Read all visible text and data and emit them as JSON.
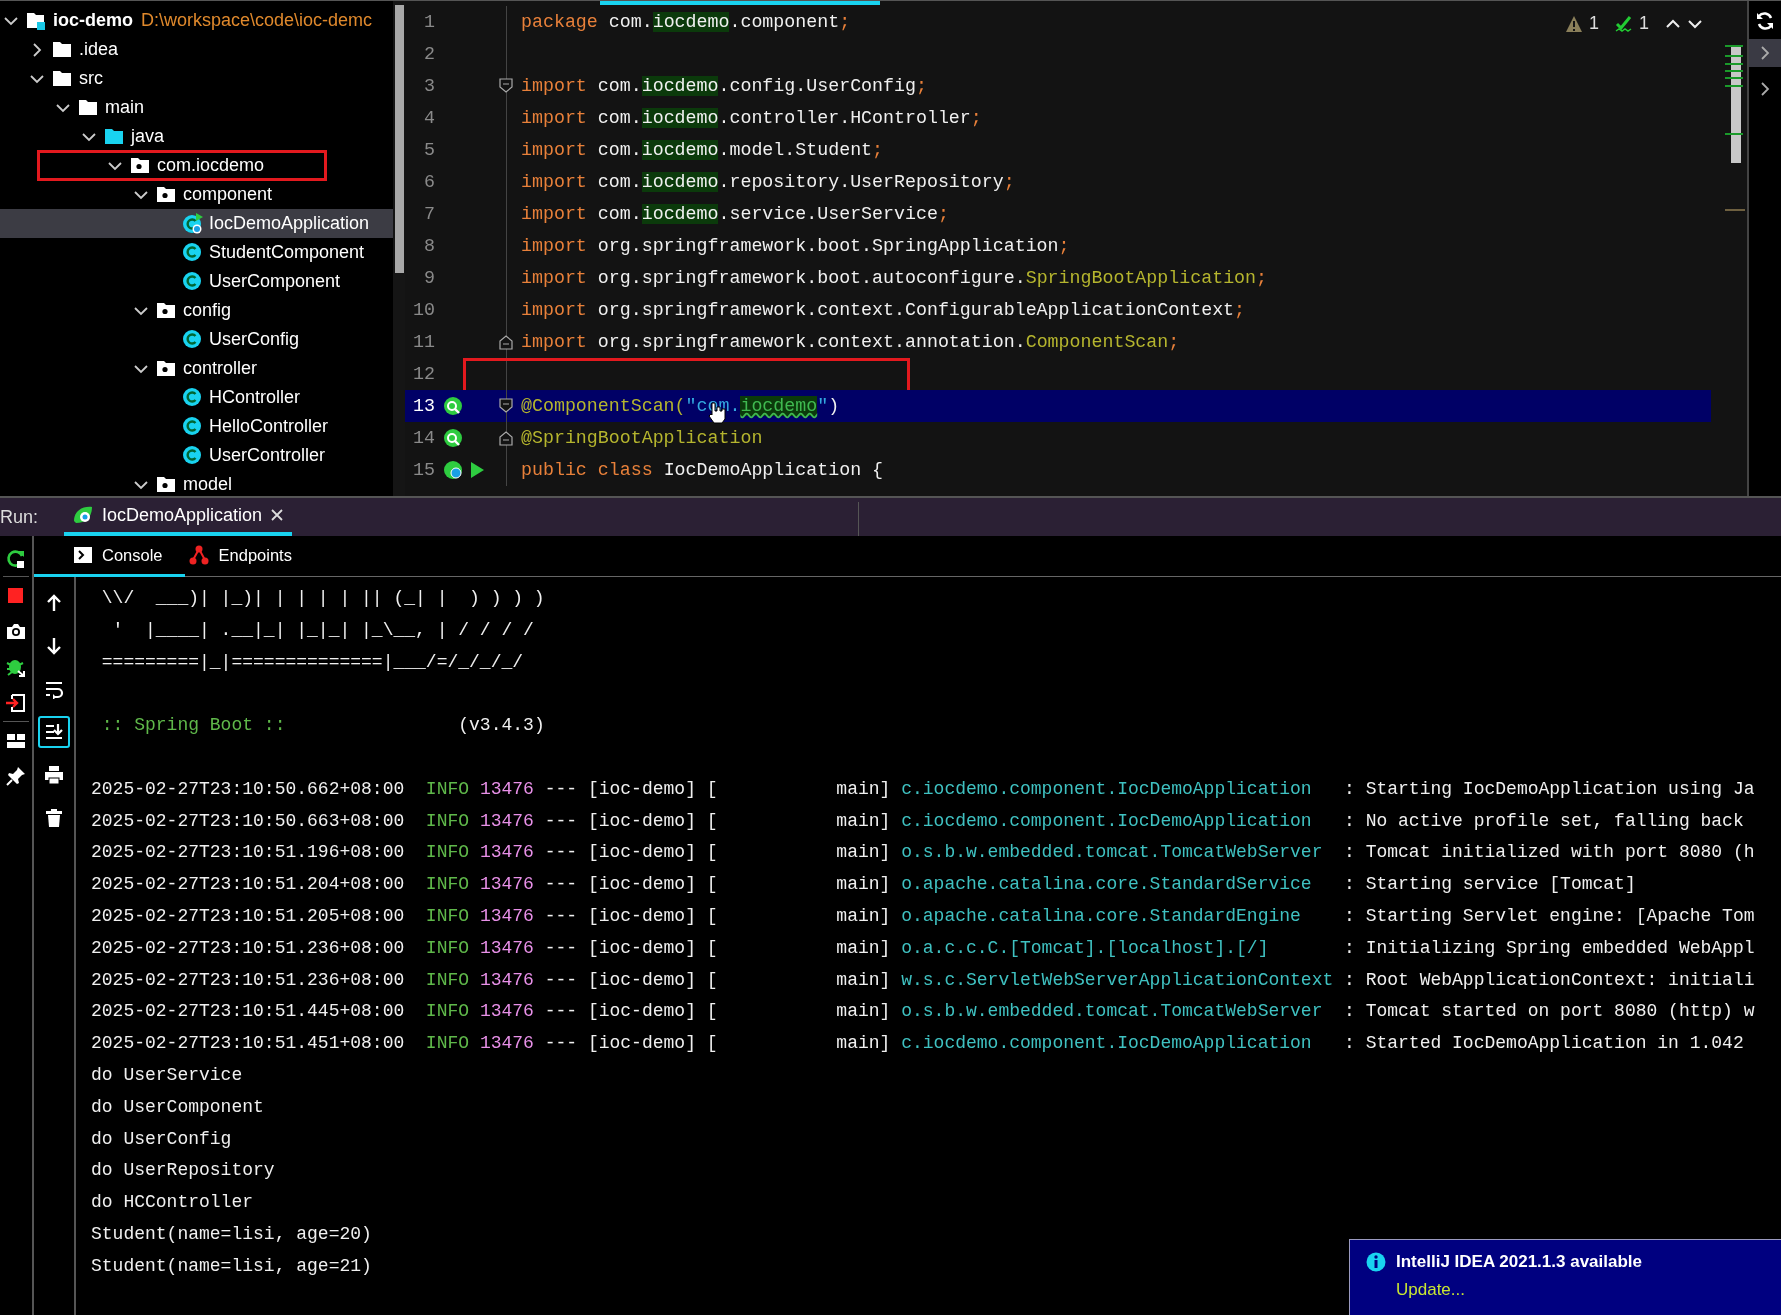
{
  "project_tree": {
    "items": [
      {
        "kind": "module",
        "label": "ioc-demo",
        "path": "D:\\workspace\\code\\ioc-demc",
        "expanded": true,
        "selected": false,
        "children": [
          {
            "kind": "folder",
            "label": ".idea",
            "expanded": false,
            "selected": false
          },
          {
            "kind": "folder",
            "label": "src",
            "expanded": true,
            "selected": false,
            "children": [
              {
                "kind": "folder",
                "label": "main",
                "expanded": true,
                "selected": false,
                "children": [
                  {
                    "kind": "source-root",
                    "label": "java",
                    "expanded": true,
                    "selected": false,
                    "children": [
                      {
                        "kind": "package",
                        "label": "com.iocdemo",
                        "expanded": true,
                        "selected": false,
                        "boxed": true,
                        "children": [
                          {
                            "kind": "package",
                            "label": "component",
                            "expanded": true,
                            "selected": false,
                            "children": [
                              {
                                "kind": "app-class",
                                "label": "IocDemoApplication",
                                "selected": true
                              },
                              {
                                "kind": "class",
                                "label": "StudentComponent",
                                "selected": false
                              },
                              {
                                "kind": "class",
                                "label": "UserComponent",
                                "selected": false
                              }
                            ]
                          },
                          {
                            "kind": "package",
                            "label": "config",
                            "expanded": true,
                            "selected": false,
                            "children": [
                              {
                                "kind": "class",
                                "label": "UserConfig",
                                "selected": false
                              }
                            ]
                          },
                          {
                            "kind": "package",
                            "label": "controller",
                            "expanded": true,
                            "selected": false,
                            "children": [
                              {
                                "kind": "class",
                                "label": "HController",
                                "selected": false
                              },
                              {
                                "kind": "class",
                                "label": "HelloController",
                                "selected": false
                              },
                              {
                                "kind": "class",
                                "label": "UserController",
                                "selected": false
                              }
                            ]
                          },
                          {
                            "kind": "package",
                            "label": "model",
                            "expanded": true,
                            "selected": false
                          }
                        ]
                      }
                    ]
                  }
                ]
              }
            ]
          }
        ]
      }
    ]
  },
  "editor": {
    "inspections": [
      {
        "kind": "warning",
        "count": "1"
      },
      {
        "kind": "typo",
        "count": "1"
      }
    ],
    "lines": [
      {
        "number": "1",
        "current": false,
        "tokens": [
          {
            "kind": "kw",
            "text": "package"
          },
          {
            "kind": "plain",
            "text": " com."
          },
          {
            "kind": "match",
            "text": "iocdemo"
          },
          {
            "kind": "plain",
            "text": ".component"
          },
          {
            "kind": "punc",
            "text": ";"
          }
        ]
      },
      {
        "number": "2",
        "current": false
      },
      {
        "number": "3",
        "current": false,
        "fold_start": true,
        "tokens": [
          {
            "kind": "kw",
            "text": "import"
          },
          {
            "kind": "plain",
            "text": " com."
          },
          {
            "kind": "match",
            "text": "iocdemo"
          },
          {
            "kind": "plain",
            "text": ".config.UserConfig"
          },
          {
            "kind": "punc",
            "text": ";"
          }
        ]
      },
      {
        "number": "4",
        "current": false,
        "tokens": [
          {
            "kind": "kw",
            "text": "import"
          },
          {
            "kind": "plain",
            "text": " com."
          },
          {
            "kind": "match",
            "text": "iocdemo"
          },
          {
            "kind": "plain",
            "text": ".controller.HController"
          },
          {
            "kind": "punc",
            "text": ";"
          }
        ]
      },
      {
        "number": "5",
        "current": false,
        "tokens": [
          {
            "kind": "kw",
            "text": "import"
          },
          {
            "kind": "plain",
            "text": " com."
          },
          {
            "kind": "match",
            "text": "iocdemo"
          },
          {
            "kind": "plain",
            "text": ".model.Student"
          },
          {
            "kind": "punc",
            "text": ";"
          }
        ]
      },
      {
        "number": "6",
        "current": false,
        "tokens": [
          {
            "kind": "kw",
            "text": "import"
          },
          {
            "kind": "plain",
            "text": " com."
          },
          {
            "kind": "match",
            "text": "iocdemo"
          },
          {
            "kind": "plain",
            "text": ".repository.UserRepository"
          },
          {
            "kind": "punc",
            "text": ";"
          }
        ]
      },
      {
        "number": "7",
        "current": false,
        "tokens": [
          {
            "kind": "kw",
            "text": "import"
          },
          {
            "kind": "plain",
            "text": " com."
          },
          {
            "kind": "match",
            "text": "iocdemo"
          },
          {
            "kind": "plain",
            "text": ".service.UserService"
          },
          {
            "kind": "punc",
            "text": ";"
          }
        ]
      },
      {
        "number": "8",
        "current": false,
        "tokens": [
          {
            "kind": "kw",
            "text": "import"
          },
          {
            "kind": "plain",
            "text": " org.springframework.boot.SpringApplication"
          },
          {
            "kind": "punc",
            "text": ";"
          }
        ]
      },
      {
        "number": "9",
        "current": false,
        "tokens": [
          {
            "kind": "kw",
            "text": "import"
          },
          {
            "kind": "plain",
            "text": " org.springframework.boot.autoconfigure."
          },
          {
            "kind": "ann",
            "text": "SpringBootApplication"
          },
          {
            "kind": "punc",
            "text": ";"
          }
        ]
      },
      {
        "number": "10",
        "current": false,
        "tokens": [
          {
            "kind": "kw",
            "text": "import"
          },
          {
            "kind": "plain",
            "text": " org.springframework.context.ConfigurableApplicationContext"
          },
          {
            "kind": "punc",
            "text": ";"
          }
        ]
      },
      {
        "number": "11",
        "current": false,
        "fold_end": true,
        "tokens": [
          {
            "kind": "kw",
            "text": "import"
          },
          {
            "kind": "plain",
            "text": " org.springframework.context.annotation."
          },
          {
            "kind": "ann",
            "text": "ComponentScan"
          },
          {
            "kind": "punc",
            "text": ";"
          }
        ]
      },
      {
        "number": "12",
        "current": false,
        "boxed": true
      },
      {
        "number": "13",
        "current": true,
        "boxed": true,
        "bean": true,
        "fold_start": true,
        "pointer": true,
        "tokens": [
          {
            "kind": "ann",
            "text": "@ComponentScan("
          },
          {
            "kind": "str",
            "text": "\"com."
          },
          {
            "kind": "typo",
            "text": "iocdemo"
          },
          {
            "kind": "str",
            "text": "\""
          },
          {
            "kind": "plain",
            "text": ")"
          }
        ]
      },
      {
        "number": "14",
        "current": false,
        "bean": true,
        "fold_end": true,
        "tokens": [
          {
            "kind": "ann",
            "text": "@SpringBootApplication"
          }
        ]
      },
      {
        "number": "15",
        "current": false,
        "bean": true,
        "run": true,
        "tokens": [
          {
            "kind": "kw",
            "text": "public class"
          },
          {
            "kind": "plain",
            "text": " IocDemoApplication {"
          }
        ]
      }
    ]
  },
  "run_bar": {
    "label": "Run:",
    "tabs": [
      {
        "title": "IocDemoApplication",
        "selected": true
      }
    ]
  },
  "console": {
    "tabs": [
      {
        "kind": "console",
        "label": "Console",
        "selected": true
      },
      {
        "kind": "endpoints",
        "label": "Endpoints",
        "selected": false
      }
    ],
    "side_actions": [
      {
        "kind": "rerun"
      },
      {
        "kind": "stop"
      },
      {
        "kind": "camera"
      },
      {
        "kind": "bug"
      },
      {
        "kind": "exit"
      },
      {
        "kind": "layout"
      },
      {
        "kind": "pin"
      }
    ],
    "toolbar": [
      {
        "kind": "up",
        "on": false
      },
      {
        "kind": "down",
        "on": false
      },
      {
        "kind": "wrap",
        "on": false
      },
      {
        "kind": "scroll-end",
        "on": true
      },
      {
        "kind": "print",
        "on": false
      },
      {
        "kind": "trash",
        "on": false
      }
    ],
    "lines": [
      {
        "kind": "plain",
        "text": " \\\\/  ___)| |_)| | | | | || (_| |  ) ) ) )"
      },
      {
        "kind": "plain",
        "text": "  '  |____| .__|_| |_|_| |_\\__, | / / / /"
      },
      {
        "kind": "plain",
        "text": " =========|_|==============|___/=/_/_/_/"
      },
      {
        "kind": "blank"
      },
      {
        "kind": "version",
        "label": " :: Spring Boot ::",
        "version": "(v3.4.3)"
      },
      {
        "kind": "blank"
      },
      {
        "kind": "log",
        "timestamp": "2025-02-27T23:10:50.662+08:00",
        "level": "INFO",
        "pid": "13476",
        "separator": "---",
        "app": "[ioc-demo]",
        "thread": "[           main]",
        "logger": "c.iocdemo.component.IocDemoApplication",
        "message": ": Starting IocDemoApplication using Ja"
      },
      {
        "kind": "log",
        "timestamp": "2025-02-27T23:10:50.663+08:00",
        "level": "INFO",
        "pid": "13476",
        "separator": "---",
        "app": "[ioc-demo]",
        "thread": "[           main]",
        "logger": "c.iocdemo.component.IocDemoApplication",
        "message": ": No active profile set, falling back"
      },
      {
        "kind": "log",
        "timestamp": "2025-02-27T23:10:51.196+08:00",
        "level": "INFO",
        "pid": "13476",
        "separator": "---",
        "app": "[ioc-demo]",
        "thread": "[           main]",
        "logger": "o.s.b.w.embedded.tomcat.TomcatWebServer",
        "message": ": Tomcat initialized with port 8080 (h"
      },
      {
        "kind": "log",
        "timestamp": "2025-02-27T23:10:51.204+08:00",
        "level": "INFO",
        "pid": "13476",
        "separator": "---",
        "app": "[ioc-demo]",
        "thread": "[           main]",
        "logger": "o.apache.catalina.core.StandardService",
        "message": ": Starting service [Tomcat]"
      },
      {
        "kind": "log",
        "timestamp": "2025-02-27T23:10:51.205+08:00",
        "level": "INFO",
        "pid": "13476",
        "separator": "---",
        "app": "[ioc-demo]",
        "thread": "[           main]",
        "logger": "o.apache.catalina.core.StandardEngine",
        "message": ": Starting Servlet engine: [Apache Tom"
      },
      {
        "kind": "log",
        "timestamp": "2025-02-27T23:10:51.236+08:00",
        "level": "INFO",
        "pid": "13476",
        "separator": "---",
        "app": "[ioc-demo]",
        "thread": "[           main]",
        "logger": "o.a.c.c.C.[Tomcat].[localhost].[/]",
        "message": ": Initializing Spring embedded WebAppl"
      },
      {
        "kind": "log",
        "timestamp": "2025-02-27T23:10:51.236+08:00",
        "level": "INFO",
        "pid": "13476",
        "separator": "---",
        "app": "[ioc-demo]",
        "thread": "[           main]",
        "logger": "w.s.c.ServletWebServerApplicationContext",
        "message": ": Root WebApplicationContext: initiali"
      },
      {
        "kind": "log",
        "timestamp": "2025-02-27T23:10:51.445+08:00",
        "level": "INFO",
        "pid": "13476",
        "separator": "---",
        "app": "[ioc-demo]",
        "thread": "[           main]",
        "logger": "o.s.b.w.embedded.tomcat.TomcatWebServer",
        "message": ": Tomcat started on port 8080 (http) w"
      },
      {
        "kind": "log",
        "timestamp": "2025-02-27T23:10:51.451+08:00",
        "level": "INFO",
        "pid": "13476",
        "separator": "---",
        "app": "[ioc-demo]",
        "thread": "[           main]",
        "logger": "c.iocdemo.component.IocDemoApplication",
        "message": ": Started IocDemoApplication in 1.042"
      },
      {
        "kind": "plain",
        "text": "do UserService"
      },
      {
        "kind": "plain",
        "text": "do UserComponent"
      },
      {
        "kind": "plain",
        "text": "do UserConfig"
      },
      {
        "kind": "plain",
        "text": "do UserRepository"
      },
      {
        "kind": "plain",
        "text": "do HCController"
      },
      {
        "kind": "plain",
        "text": "Student(name=lisi, age=20)"
      },
      {
        "kind": "plain",
        "text": "Student(name=lisi, age=21)"
      }
    ]
  },
  "notification": {
    "title": "IntelliJ IDEA 2021.1.3 available",
    "action": "Update..."
  }
}
